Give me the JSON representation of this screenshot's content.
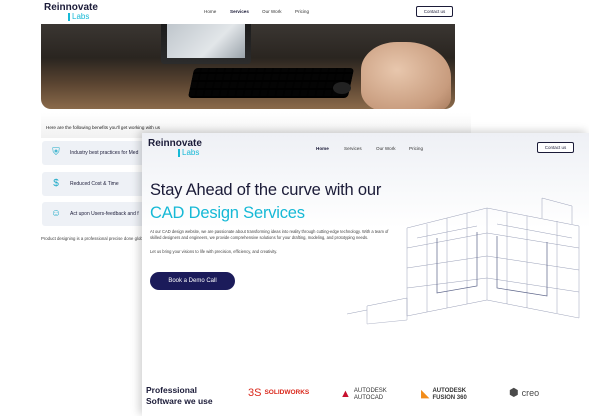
{
  "back_page": {
    "logo": {
      "line1": "Reinnovate",
      "line2": "Labs"
    },
    "nav": [
      "Home",
      "Services",
      "Our Work",
      "Pricing"
    ],
    "contact_label": "Contact us",
    "benefits_title": "Here are the following benefits you'll get working with us",
    "benefits": [
      {
        "icon": "shield-check-icon",
        "label": "Industry best practices for Med"
      },
      {
        "icon": "dollar-icon",
        "label": "Reduced Cost & Time"
      },
      {
        "icon": "feedback-icon",
        "label": "Act upon Users-feedback and f"
      }
    ],
    "note": "Product designing is a professional precise done glob"
  },
  "front_page": {
    "logo": {
      "line1": "Reinnovate",
      "line2": "Labs"
    },
    "nav": [
      "Home",
      "Services",
      "Our Work",
      "Pricing"
    ],
    "contact_label": "Contact us",
    "headline_line1": "Stay Ahead of the curve with our",
    "headline_line2": "CAD Design Services",
    "paragraph": "At our CAD design website, we are passionate about transforming ideas into reality through cutting-edge technology. With a team of skilled designers and engineers, we provide comprehensive solutions for your drafting, modeling, and prototyping needs.",
    "paragraph2": "Let us bring your visions to life with precision, efficiency, and creativity.",
    "cta_label": "Book a Demo Call",
    "software_title_line1": "Professional",
    "software_title_line2": "Software we use",
    "brands": [
      {
        "name": "SOLIDWORKS",
        "prefix": "3S",
        "icon": "solidworks-logo"
      },
      {
        "name": "AUTODESK",
        "sub": "AUTOCAD",
        "icon": "autocad-logo"
      },
      {
        "name": "AUTODESK",
        "sub": "FUSION 360",
        "icon": "fusion360-logo"
      },
      {
        "name": "creo",
        "icon": "creo-logo"
      }
    ]
  },
  "colors": {
    "navy": "#1b1b38",
    "accent_cyan": "#16b9d6",
    "cta_bg": "#1b1b5a"
  }
}
